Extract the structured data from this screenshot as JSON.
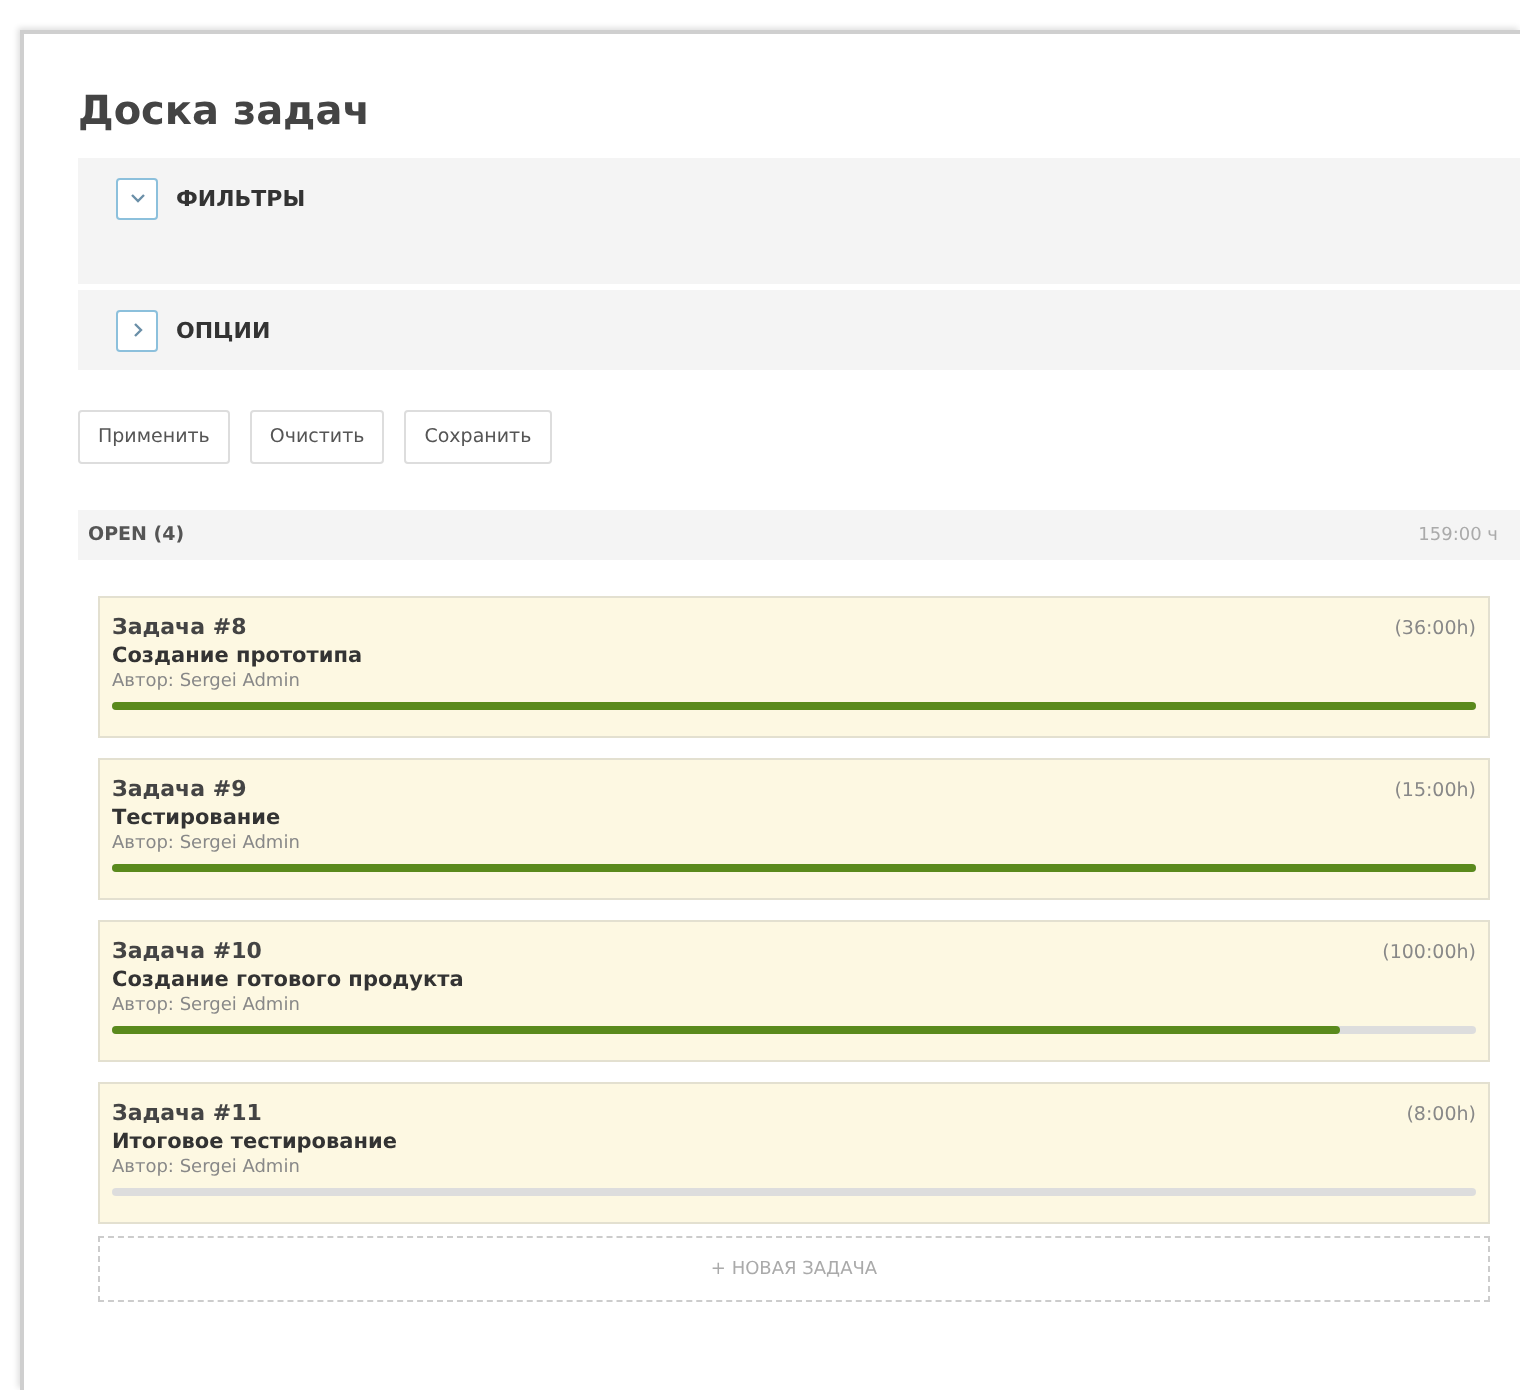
{
  "title": "Доска задач",
  "panels": [
    {
      "label": "ФИЛЬТРЫ",
      "expanded": true
    },
    {
      "label": "ОПЦИИ",
      "expanded": false
    }
  ],
  "buttons": [
    "Применить",
    "Очистить",
    "Сохранить"
  ],
  "column": {
    "label": "OPEN (4)",
    "total": "159:00 ч"
  },
  "tasks": [
    {
      "number": "Задача #8",
      "name": "Создание прототипа",
      "author": "Автор: Sergei Admin",
      "hours": "(36:00h)",
      "level": 1
    },
    {
      "number": "Задача #9",
      "name": "Тестирование",
      "author": "Автор: Sergei Admin",
      "hours": "(15:00h)",
      "level": 1
    },
    {
      "number": "Задача #10",
      "name": "Создание готового продукта",
      "author": "Автор: Sergei Admin",
      "hours": "(100:00h)",
      "level": 0.9
    },
    {
      "number": "Задача #11",
      "name": "Итоговое тестирование",
      "author": "Автор: Sergei Admin",
      "hours": "(8:00h)",
      "level": 0
    }
  ],
  "new_task": "+ НОВАЯ ЗАДАЧА"
}
